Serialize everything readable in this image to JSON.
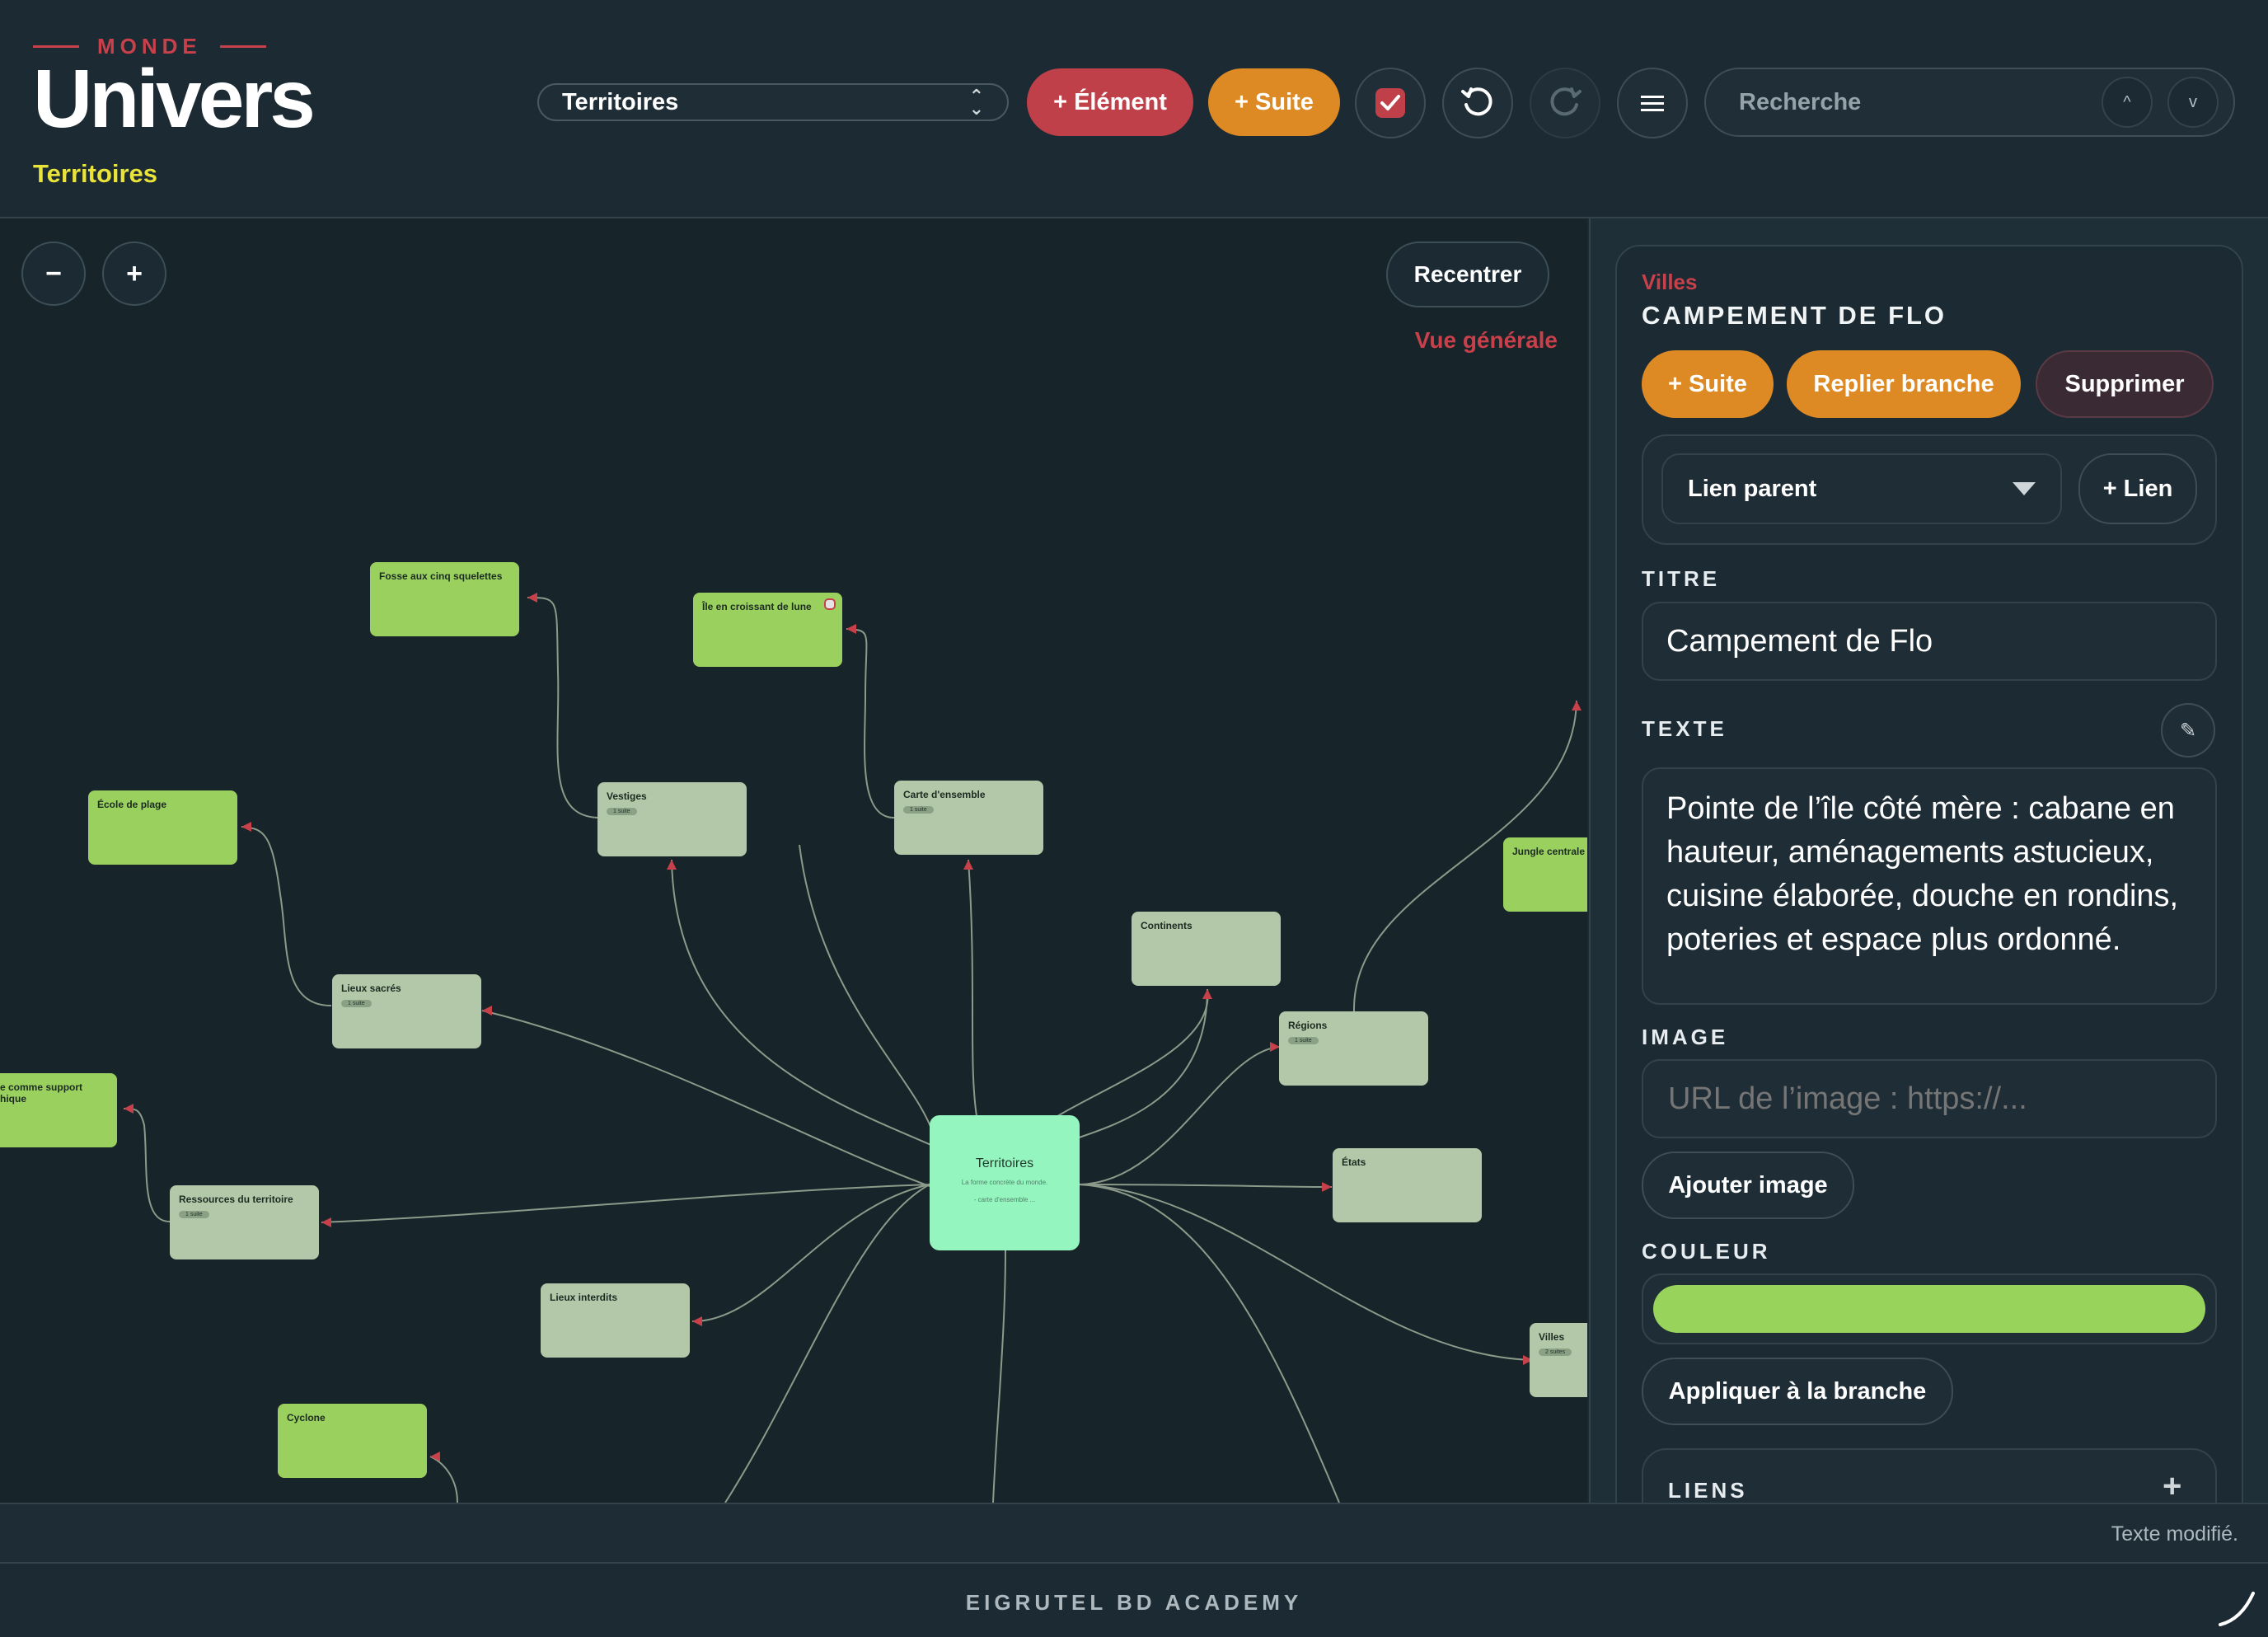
{
  "header": {
    "eyebrow": "MONDE",
    "title": "Univers",
    "subtitle": "Territoires",
    "select_value": "Territoires",
    "add_element_label": "+ Élément",
    "add_suite_label": "+ Suite",
    "search_placeholder": "Recherche",
    "search_prev": "^",
    "search_next": "v"
  },
  "canvas": {
    "zoom_out": "−",
    "zoom_in": "+",
    "recenter_label": "Recentrer",
    "overview_label": "Vue générale",
    "nodes": {
      "territoires": {
        "title": "Territoires",
        "desc1": "La forme concrète du monde.",
        "desc2": "- carte d'ensemble ..."
      },
      "fosse": {
        "title": "Fosse aux cinq squelettes"
      },
      "ile": {
        "title": "Île en croissant de lune"
      },
      "jungle": {
        "title": "Jungle centrale"
      },
      "ecole": {
        "title": "École de plage"
      },
      "vestiges": {
        "title": "Vestiges",
        "badge": "1 suite"
      },
      "carte": {
        "title": "Carte d'ensemble",
        "badge": "1 suite"
      },
      "continents": {
        "title": "Continents"
      },
      "lieux_sacres": {
        "title": "Lieux sacrés",
        "badge": "1 suite"
      },
      "regions": {
        "title": "Régions",
        "badge": "1 suite"
      },
      "support": {
        "title": "e comme support",
        "title2": "hique"
      },
      "ressources": {
        "title": "Ressources du territoire",
        "badge": "1 suite"
      },
      "etats": {
        "title": "États"
      },
      "lieux_interdits": {
        "title": "Lieux interdits"
      },
      "villes": {
        "title": "Villes",
        "badge": "2 suites"
      },
      "cyclone": {
        "title": "Cyclone"
      }
    }
  },
  "panel": {
    "category": "Villes",
    "heading": "CAMPEMENT DE FLO",
    "suite_label": "+ Suite",
    "fold_label": "Replier branche",
    "delete_label": "Supprimer",
    "link_select": "Lien parent",
    "add_link_label": "+ Lien",
    "title_label": "TITRE",
    "title_value": "Campement de Flo",
    "text_label": "TEXTE",
    "text_value": "Pointe de l’île côté mère : cabane en hauteur, aménagements astucieux, cuisine élaborée, douche en rondins, poteries et espace plus ordonné.",
    "image_label": "IMAGE",
    "image_placeholder": "URL de l’image : https://...",
    "add_image_label": "Ajouter image",
    "color_label": "COULEUR",
    "color_value": "#98d35c",
    "apply_branch_label": "Appliquer à la branche",
    "links_label": "LIENS",
    "links_add": "+"
  },
  "status": {
    "message": "Texte modifié."
  },
  "footer": {
    "brand": "EIGRUTEL BD ACADEMY"
  }
}
